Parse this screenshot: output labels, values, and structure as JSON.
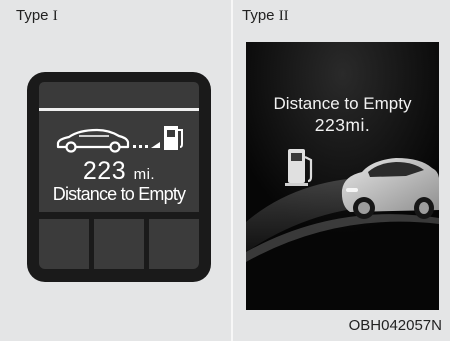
{
  "type1": {
    "label_text": "Type ",
    "label_numeral": "I",
    "value": "223",
    "unit": "mi.",
    "caption": "Distance to Empty",
    "icons": [
      "car-icon",
      "fuel-pump-icon"
    ]
  },
  "type2": {
    "label_text": "Type ",
    "label_numeral": "II",
    "caption": "Distance to Empty",
    "value": "223mi.",
    "icons": [
      "fuel-pump-icon",
      "car-icon"
    ]
  },
  "figure_id": "OBH042057N"
}
